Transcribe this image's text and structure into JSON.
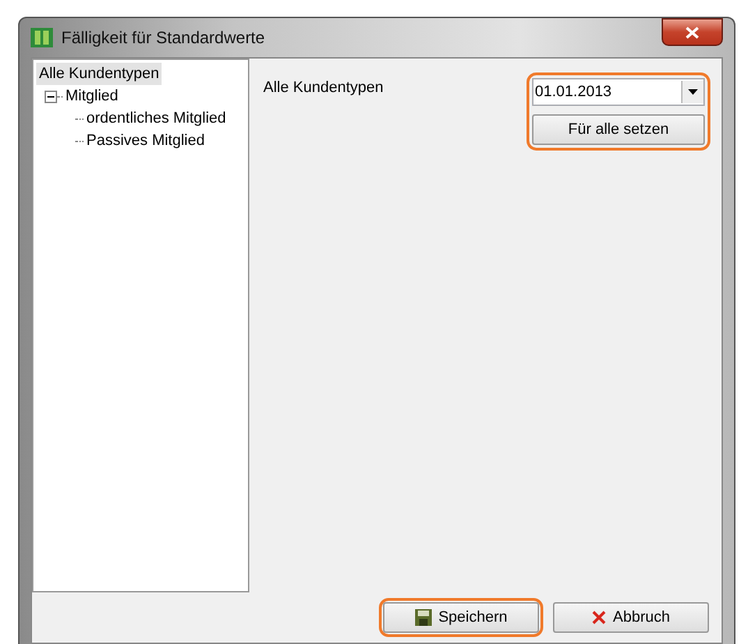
{
  "window": {
    "title": "Fälligkeit für Standardwerte"
  },
  "tree": [
    {
      "label": "Alle Kundentypen",
      "selected": true
    },
    {
      "label": "Mitglied",
      "selected": false,
      "expanded": true,
      "children": [
        {
          "label": "ordentliches Mitglied",
          "selected": false
        },
        {
          "label": "Passives Mitglied",
          "selected": false
        }
      ]
    }
  ],
  "detail": {
    "label": "Alle Kundentypen",
    "date": "01.01.2013",
    "apply_button": "Für alle setzen"
  },
  "buttons": [
    {
      "kind": "save",
      "label": "Speichern",
      "highlighted": true
    },
    {
      "kind": "cancel",
      "label": "Abbruch",
      "highlighted": false
    }
  ]
}
